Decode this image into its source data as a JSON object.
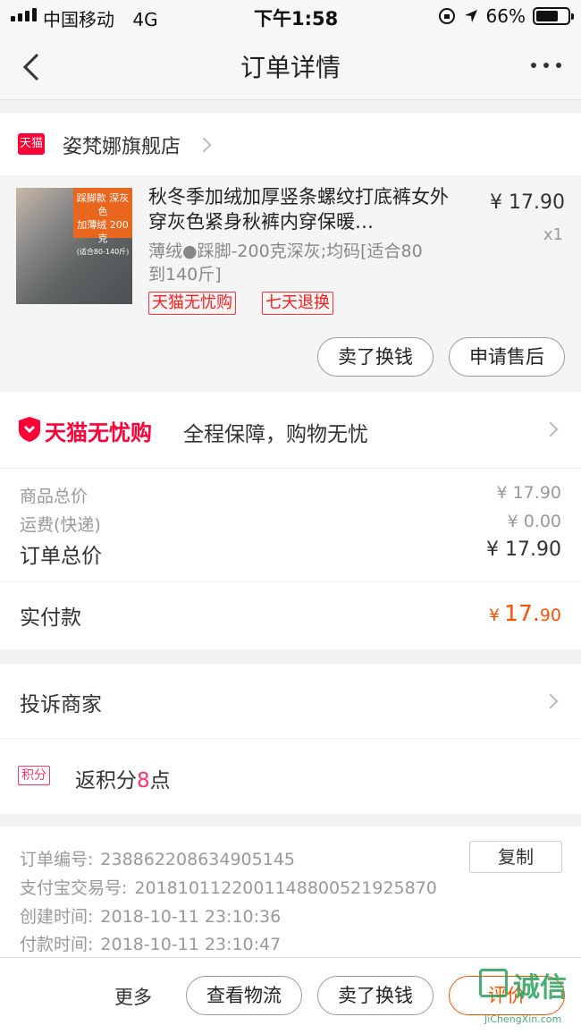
{
  "status_bar": {
    "carrier": "中国移动",
    "network": "4G",
    "time": "下午1:58",
    "battery": "66%",
    "battery_level": 0.66
  },
  "nav": {
    "title": "订单详情"
  },
  "shop": {
    "name": "姿梵娜旗舰店",
    "platform_badge": "天猫"
  },
  "product": {
    "name": "秋冬季加绒加厚竖条螺纹打底裤女外穿灰色紧身秋裤内穿保暖…",
    "price": "¥ 17.90",
    "quantity": "x1",
    "spec": "薄绒●踩脚-200克深灰;均码[适合80到140斤]",
    "thumb_text": [
      "踩脚款 深灰色",
      "加薄绒 200克",
      "(适合80-140斤)"
    ],
    "badges": [
      "天猫无忧购",
      "七天退换"
    ],
    "actions": [
      "卖了换钱",
      "申请售后"
    ]
  },
  "guarantee": {
    "logo": "天猫无忧购",
    "text": "全程保障，购物无忧"
  },
  "totals": {
    "goods_label": "商品总价",
    "goods_value": "¥ 17.90",
    "shipping_label": "运费(快递)",
    "shipping_value": "¥ 0.00",
    "order_label": "订单总价",
    "order_value": "¥ 17.90",
    "paid_label": "实付款",
    "paid_currency": "¥",
    "paid_int": "17.",
    "paid_dec": "90"
  },
  "complaint": {
    "label": "投诉商家"
  },
  "points": {
    "badge": "积分",
    "prefix": "返积分",
    "count": "8",
    "suffix": "点"
  },
  "order_info": {
    "order_no_label": "订单编号:",
    "order_no": "238862208634905145",
    "alipay_label": "支付宝交易号:",
    "alipay_no": "2018101122001148800521925870",
    "created_label": "创建时间:",
    "created": "2018-10-11 23:10:36",
    "paid_label": "付款时间:",
    "paid": "2018-10-11 23:10:47",
    "copy_button": "复制"
  },
  "footer": {
    "more": "更多",
    "buttons": [
      "查看物流",
      "卖了换钱",
      "评价"
    ]
  },
  "watermark": {
    "text": "诚信",
    "url": "JiChengXin.com"
  },
  "colors": {
    "tmall_red": "#ff0036",
    "price_orange": "#ff5000",
    "badge_red": "#ff1a1a"
  }
}
